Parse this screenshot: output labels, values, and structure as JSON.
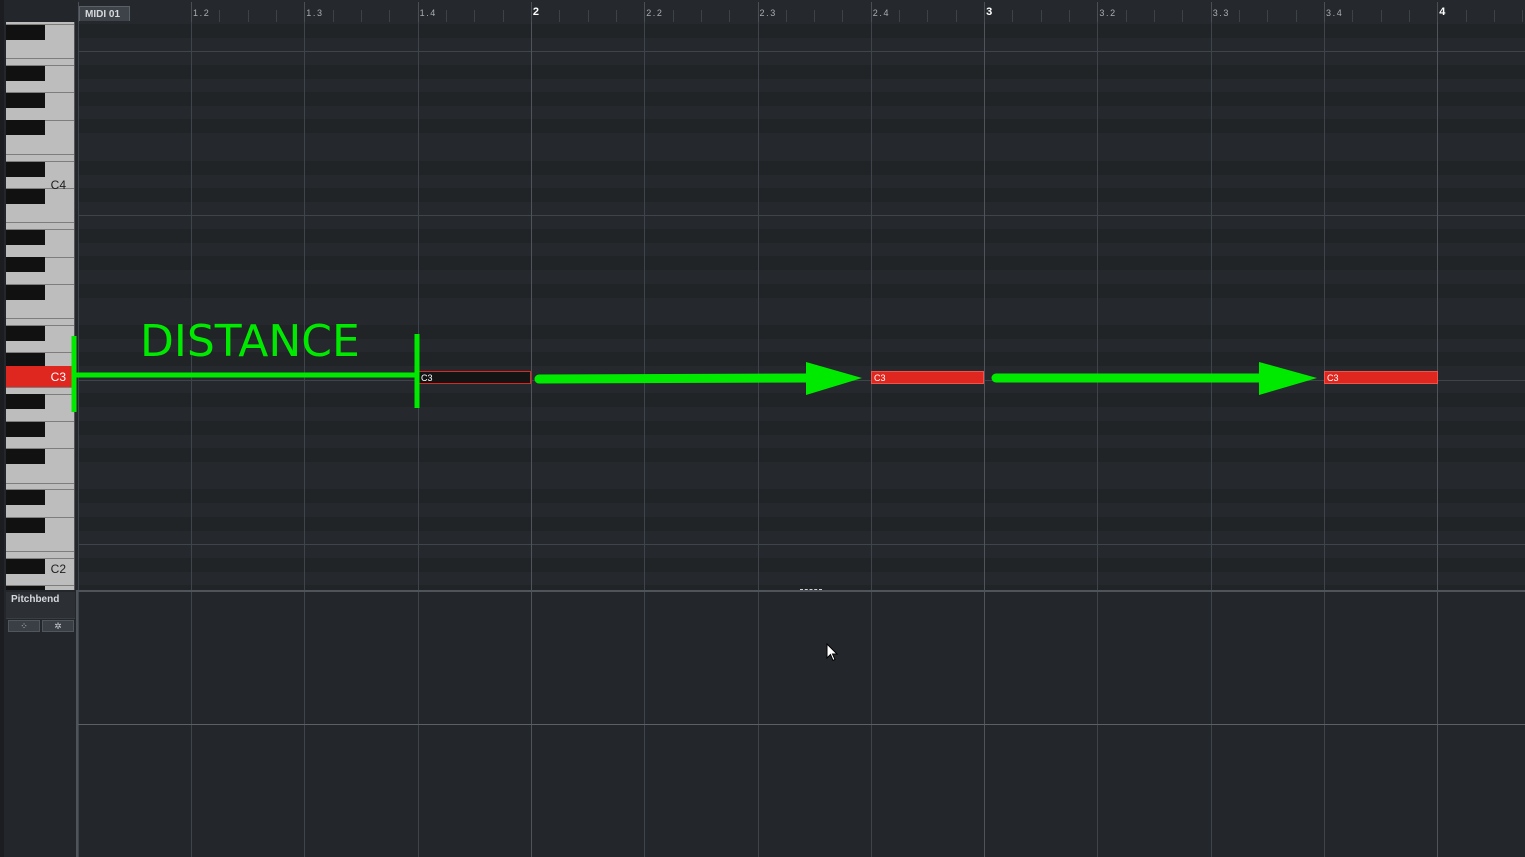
{
  "editor": {
    "part_name": "MIDI 01"
  },
  "ruler": {
    "labels": [
      "1.2",
      "1.3",
      "1.4",
      "2",
      "2.2",
      "2.3",
      "2.4",
      "3",
      "3.2",
      "3.3",
      "3.4",
      "4"
    ]
  },
  "keyboard": {
    "labels": [
      "C4",
      "C3",
      "C2"
    ],
    "active_key": "C3"
  },
  "notes": [
    {
      "label": "C3",
      "state": "selected"
    },
    {
      "label": "C3",
      "state": "normal"
    },
    {
      "label": "C3",
      "state": "normal"
    }
  ],
  "controller_lane": {
    "name": "Pitchbend",
    "buttons": [
      "⁘",
      "✲"
    ]
  },
  "annotation": {
    "text": "DISTANCE",
    "color": "#00ea00"
  },
  "colors": {
    "note_fill": "#e0271f",
    "background": "#23272b"
  }
}
